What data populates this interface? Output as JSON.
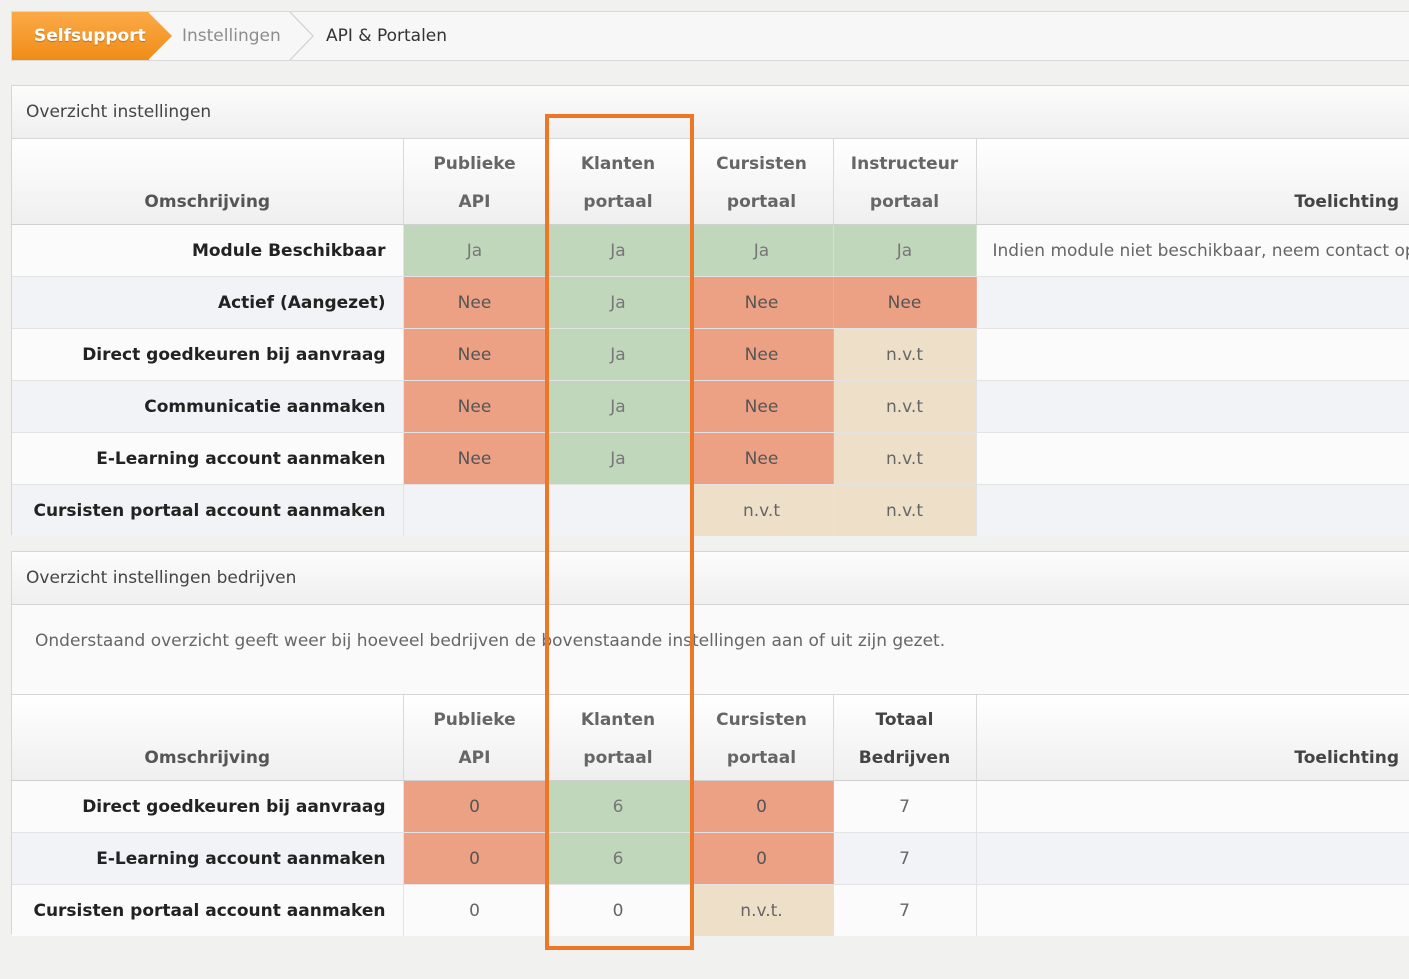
{
  "breadcrumb": {
    "home": "Selfsupport",
    "level2": "Instellingen",
    "current": "API & Portalen"
  },
  "panel1": {
    "title": "Overzicht instellingen",
    "headers": {
      "omschrijving": "Omschrijving",
      "publieke_1": "Publieke",
      "publieke_2": "API",
      "klanten_1": "Klanten",
      "klanten_2": "portaal",
      "cursisten_1": "Cursisten",
      "cursisten_2": "portaal",
      "instructeur_1": "Instructeur",
      "instructeur_2": "portaal",
      "toelichting": "Toelichting"
    },
    "rows": [
      {
        "label": "Module Beschikbaar",
        "publieke": "Ja",
        "klanten": "Ja",
        "cursisten": "Ja",
        "instructeur": "Ja",
        "toelichting": "Indien module niet beschikbaar, neem contact op"
      },
      {
        "label": "Actief (Aangezet)",
        "publieke": "Nee",
        "klanten": "Ja",
        "cursisten": "Nee",
        "instructeur": "Nee",
        "toelichting": ""
      },
      {
        "label": "Direct goedkeuren bij aanvraag",
        "publieke": "Nee",
        "klanten": "Ja",
        "cursisten": "Nee",
        "instructeur": "n.v.t",
        "toelichting": ""
      },
      {
        "label": "Communicatie aanmaken",
        "publieke": "Nee",
        "klanten": "Ja",
        "cursisten": "Nee",
        "instructeur": "n.v.t",
        "toelichting": ""
      },
      {
        "label": "E-Learning account aanmaken",
        "publieke": "Nee",
        "klanten": "Ja",
        "cursisten": "Nee",
        "instructeur": "n.v.t",
        "toelichting": ""
      },
      {
        "label": "Cursisten portaal account aanmaken",
        "publieke": "",
        "klanten": "",
        "cursisten": "n.v.t",
        "instructeur": "n.v.t",
        "toelichting": ""
      }
    ]
  },
  "panel2": {
    "title": "Overzicht instellingen bedrijven",
    "note": "Onderstaand overzicht geeft weer bij hoeveel bedrijven de bovenstaande instellingen aan of uit zijn gezet.",
    "headers": {
      "omschrijving": "Omschrijving",
      "publieke_1": "Publieke",
      "publieke_2": "API",
      "klanten_1": "Klanten",
      "klanten_2": "portaal",
      "cursisten_1": "Cursisten",
      "cursisten_2": "portaal",
      "totaal_1": "Totaal",
      "totaal_2": "Bedrijven",
      "toelichting": "Toelichting"
    },
    "rows": [
      {
        "label": "Direct goedkeuren bij aanvraag",
        "publieke": "0",
        "klanten": "6",
        "cursisten": "0",
        "totaal": "7",
        "toelichting": ""
      },
      {
        "label": "E-Learning account aanmaken",
        "publieke": "0",
        "klanten": "6",
        "cursisten": "0",
        "totaal": "7",
        "toelichting": ""
      },
      {
        "label": "Cursisten portaal account aanmaken",
        "publieke": "0",
        "klanten": "0",
        "cursisten": "n.v.t.",
        "totaal": "7",
        "toelichting": ""
      }
    ]
  },
  "colors": {
    "ja": "#c1d7bc",
    "nee": "#eca084",
    "nvt": "#eedfc9",
    "highlight": "#ec7727",
    "home": "#f39a2c"
  }
}
